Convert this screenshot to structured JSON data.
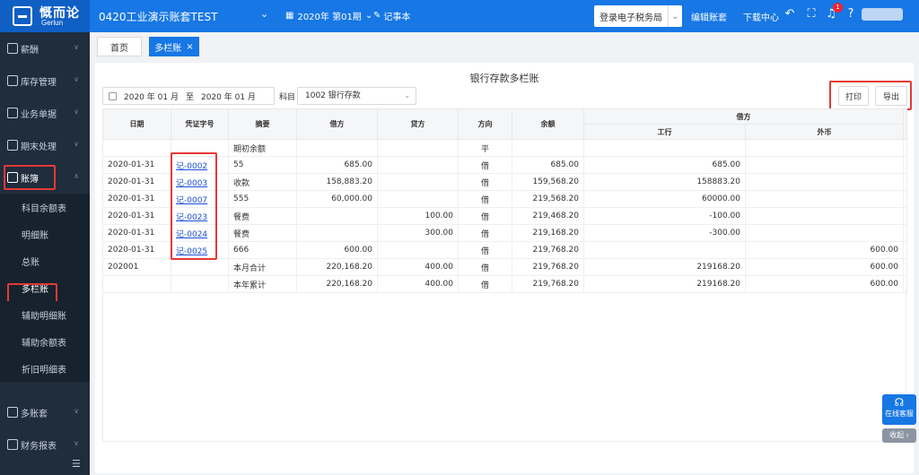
{
  "app": {
    "logo_text": "慨而论",
    "logo_sub": "Gerlun"
  },
  "header": {
    "account_name": "0420工业演示账套TEST",
    "period": "2020年 第01期",
    "notepad": "记事本",
    "tax_login": "登录电子税务局",
    "edit_account": "编辑账套",
    "download_center": "下载中心",
    "notification_count": "1"
  },
  "sidebar": {
    "items": [
      {
        "label": "薪酬"
      },
      {
        "label": "库存管理"
      },
      {
        "label": "业务单据"
      },
      {
        "label": "期末处理"
      },
      {
        "label": "账簿"
      },
      {
        "label": "多账套"
      },
      {
        "label": "财务报表"
      }
    ],
    "sub_items": [
      {
        "label": "科目余额表"
      },
      {
        "label": "明细账"
      },
      {
        "label": "总账"
      },
      {
        "label": "多栏账"
      },
      {
        "label": "辅助明细账"
      },
      {
        "label": "辅助余额表"
      },
      {
        "label": "折旧明细表"
      }
    ]
  },
  "tabs": [
    {
      "label": "首页"
    },
    {
      "label": "多栏账"
    }
  ],
  "report": {
    "title": "银行存款多栏账",
    "date_from": "2020 年 01 月",
    "date_sep": "至",
    "date_to": "2020 年 01 月",
    "subject_label": "科目",
    "subject_value": "1002 银行存款",
    "print_label": "打印",
    "export_label": "导出"
  },
  "table": {
    "headers": {
      "date": "日期",
      "voucher": "凭证字号",
      "summary": "摘要",
      "debit": "借方",
      "credit": "贷方",
      "direction": "方向",
      "balance": "余额",
      "debit_group": "借方",
      "sub1": "工行",
      "sub2": "外币"
    },
    "rows": [
      {
        "date": "",
        "voucher": "",
        "summary": "期初余额",
        "debit": "",
        "credit": "",
        "direction": "平",
        "balance": "",
        "icbc": "",
        "foreign": ""
      },
      {
        "date": "2020-01-31",
        "voucher": "记-0002",
        "summary": "55",
        "debit": "685.00",
        "credit": "",
        "direction": "借",
        "balance": "685.00",
        "icbc": "685.00",
        "foreign": ""
      },
      {
        "date": "2020-01-31",
        "voucher": "记-0003",
        "summary": "收款",
        "debit": "158,883.20",
        "credit": "",
        "direction": "借",
        "balance": "159,568.20",
        "icbc": "158883.20",
        "foreign": ""
      },
      {
        "date": "2020-01-31",
        "voucher": "记-0007",
        "summary": "555",
        "debit": "60,000.00",
        "credit": "",
        "direction": "借",
        "balance": "219,568.20",
        "icbc": "60000.00",
        "foreign": ""
      },
      {
        "date": "2020-01-31",
        "voucher": "记-0023",
        "summary": "餐费",
        "debit": "",
        "credit": "100.00",
        "direction": "借",
        "balance": "219,468.20",
        "icbc": "-100.00",
        "foreign": ""
      },
      {
        "date": "2020-01-31",
        "voucher": "记-0024",
        "summary": "餐费",
        "debit": "",
        "credit": "300.00",
        "direction": "借",
        "balance": "219,168.20",
        "icbc": "-300.00",
        "foreign": ""
      },
      {
        "date": "2020-01-31",
        "voucher": "记-0025",
        "summary": "666",
        "debit": "600.00",
        "credit": "",
        "direction": "借",
        "balance": "219,768.20",
        "icbc": "",
        "foreign": "600.00"
      },
      {
        "date": "202001",
        "voucher": "",
        "summary": "本月合计",
        "debit": "220,168.20",
        "credit": "400.00",
        "direction": "借",
        "balance": "219,768.20",
        "icbc": "219168.20",
        "foreign": "600.00"
      },
      {
        "date": "",
        "voucher": "",
        "summary": "本年累计",
        "debit": "220,168.20",
        "credit": "400.00",
        "direction": "借",
        "balance": "219,768.20",
        "icbc": "219168.20",
        "foreign": "600.00"
      }
    ]
  },
  "floating": {
    "service": "在线客服",
    "fold": "收起"
  },
  "colors": {
    "primary": "#1677e5",
    "sidebar": "#1f2d3d",
    "highlight": "#e53935",
    "link": "#1a4fd6"
  }
}
